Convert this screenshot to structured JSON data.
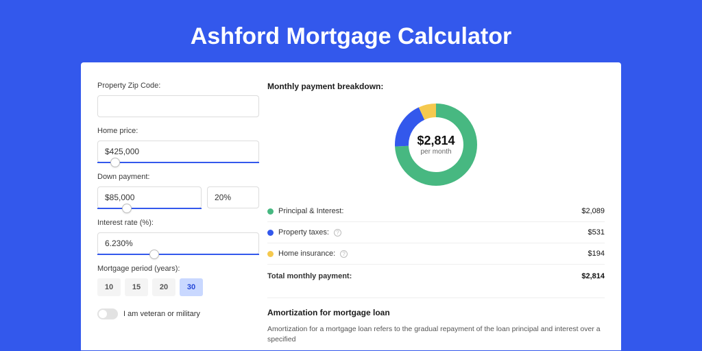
{
  "title": "Ashford Mortgage Calculator",
  "form": {
    "zip_label": "Property Zip Code:",
    "zip_value": "",
    "price_label": "Home price:",
    "price_value": "$425,000",
    "price_slider_pct": 8,
    "down_label": "Down payment:",
    "down_value": "$85,000",
    "down_pct": "20%",
    "down_slider_pct": 24,
    "rate_label": "Interest rate (%):",
    "rate_value": "6.230%",
    "rate_slider_pct": 32,
    "period_label": "Mortgage period (years):",
    "periods": [
      "10",
      "15",
      "20",
      "30"
    ],
    "period_active": "30",
    "veteran_label": "I am veteran or military"
  },
  "breakdown": {
    "title": "Monthly payment breakdown:",
    "donut_amount": "$2,814",
    "donut_sub": "per month",
    "rows": [
      {
        "color": "green",
        "label": "Principal & Interest:",
        "info": false,
        "value": "$2,089"
      },
      {
        "color": "blue",
        "label": "Property taxes:",
        "info": true,
        "value": "$531"
      },
      {
        "color": "yellow",
        "label": "Home insurance:",
        "info": true,
        "value": "$194"
      }
    ],
    "total_label": "Total monthly payment:",
    "total_value": "$2,814"
  },
  "chart_data": {
    "type": "pie",
    "title": "Monthly payment breakdown",
    "series": [
      {
        "name": "Principal & Interest",
        "value": 2089,
        "color": "#47b881"
      },
      {
        "name": "Property taxes",
        "value": 531,
        "color": "#3358ec"
      },
      {
        "name": "Home insurance",
        "value": 194,
        "color": "#f5c94e"
      }
    ],
    "total": 2814,
    "center_label": "$2,814 per month"
  },
  "amort": {
    "title": "Amortization for mortgage loan",
    "body": "Amortization for a mortgage loan refers to the gradual repayment of the loan principal and interest over a specified"
  },
  "colors": {
    "accent": "#3358ec",
    "green": "#47b881",
    "yellow": "#f5c94e"
  }
}
